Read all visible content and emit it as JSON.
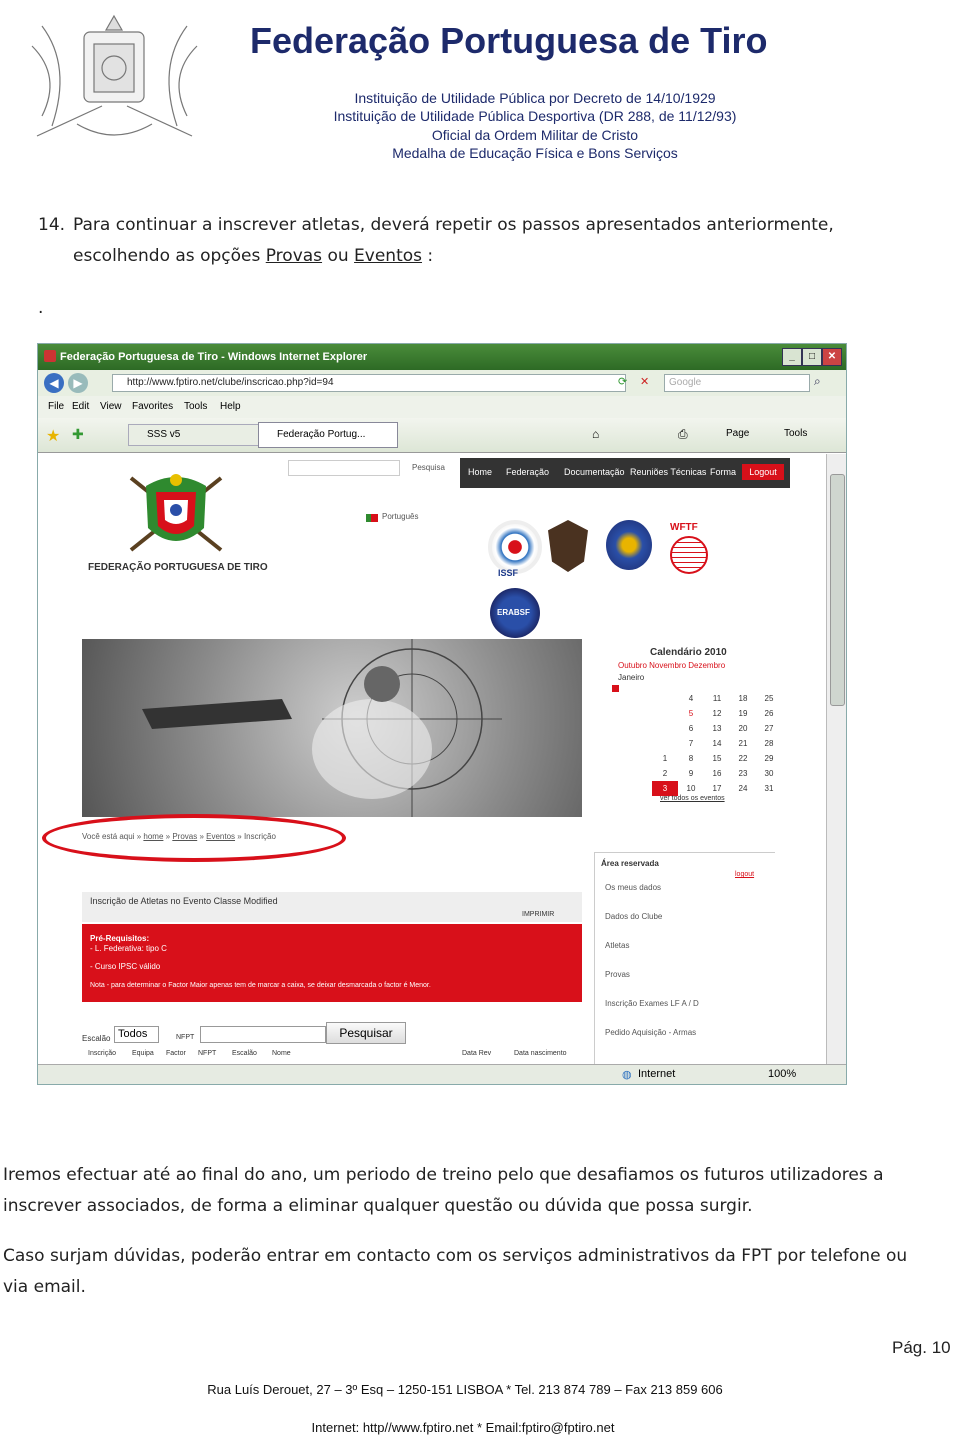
{
  "header": {
    "title": "Federação Portuguesa de Tiro",
    "lines": [
      "Instituição de Utilidade Pública por Decreto de 14/10/1929",
      "Instituição de Utilidade Pública Desportiva (DR 288, de 11/12/93)",
      "Oficial da Ordem Militar de Cristo",
      "Medalha de Educação Física e Bons Serviços"
    ]
  },
  "step": {
    "number": "14.",
    "text_a": "Para continuar a inscrever atletas, deverá repetir os passos apresentados anteriormente,",
    "text_b": "escolhendo as opções",
    "link_provas": "Provas",
    "or": "ou",
    "link_eventos": "Eventos",
    "colon": ":",
    "dot": "."
  },
  "screenshot": {
    "window_title": "Federação Portuguesa de Tiro - Windows Internet Explorer",
    "url": "http://www.fptiro.net/clube/inscricao.php?id=94",
    "search_placeholder": "Google",
    "menu": [
      "File",
      "Edit",
      "View",
      "Favorites",
      "Tools",
      "Help"
    ],
    "tab1": "SSS v5",
    "tab2": "Federação Portug...",
    "page_label": "Page",
    "tools_label": "Tools",
    "site_search": "Pesquisa",
    "nav": [
      "Home",
      "Federação",
      "Documentação",
      "Reuniões Técnicas",
      "Forma",
      "Logout"
    ],
    "language": "Português",
    "federation_name": "FEDERAÇÃO PORTUGUESA DE TIRO",
    "badges": [
      "ISSF",
      "WFTF",
      "ERABSF"
    ],
    "calendar": {
      "title": "Calendário 2010",
      "months_line1": "Outubro  Novembro  Dezembro",
      "months_line2": "Janeiro",
      "rows": [
        [
          "",
          "4",
          "11",
          "18",
          "25"
        ],
        [
          "",
          "5",
          "12",
          "19",
          "26"
        ],
        [
          "",
          "6",
          "13",
          "20",
          "27"
        ],
        [
          "",
          "7",
          "14",
          "21",
          "28"
        ],
        [
          "1",
          "8",
          "15",
          "22",
          "29"
        ],
        [
          "2",
          "9",
          "16",
          "23",
          "30"
        ],
        [
          "3",
          "10",
          "17",
          "24",
          "31"
        ]
      ],
      "link": "ver todos os eventos"
    },
    "breadcrumb": {
      "prefix": "Você está aqui »",
      "home": "home",
      "provas": "Provas",
      "eventos": "Eventos",
      "current": "Inscrição"
    },
    "form_title": "Inscrição de Atletas no Evento Classe Modified",
    "print_label": "IMPRIMIR",
    "prereq_title": "Pré-Requisitos:",
    "prereq_1": "- L. Federativa: tipo C",
    "prereq_2": "- Curso IPSC válido",
    "prereq_note": "Nota - para determinar o Factor Maior apenas tem de marcar a caixa, se deixar desmarcada o factor é Menor.",
    "filter_label": "Escalão",
    "filter_value": "Todos",
    "nfpt_label": "NFPT",
    "search_button": "Pesquisar",
    "columns": [
      "Inscrição",
      "Equipa",
      "Factor",
      "NFPT",
      "Escalão",
      "Nome",
      "Data Rev",
      "Data nascimento"
    ],
    "reserved_area": {
      "title": "Área reservada",
      "logout": "logout",
      "items": [
        "Os meus dados",
        "Dados do Clube",
        "Atletas",
        "Provas",
        "Inscrição Exames LF A / D",
        "Pedido Aquisição - Armas"
      ]
    },
    "status_internet": "Internet",
    "status_zoom": "100%"
  },
  "paragraph1": "Iremos efectuar até ao final do ano, um periodo de treino pelo que desafiamos os futuros utilizadores a inscrever associados, de forma a eliminar qualquer questão ou dúvida que possa surgir.",
  "paragraph2": "Caso surjam dúvidas, poderão entrar em contacto com os serviços administrativos da FPT por telefone ou via email.",
  "page_number": "Pág. 10",
  "footer": {
    "address": "Rua Luís Derouet, 27 – 3º Esq – 1250-151 LISBOA * Tel. 213 874 789 – Fax 213 859 606",
    "internet": "Internet: http//www.fptiro.net * Email:fptiro@fptiro.net"
  },
  "colors": {
    "header_blue": "#1d2a6b",
    "red": "#d8101a",
    "nav_dark": "#333333",
    "link_blue": "#1d3a8a"
  }
}
